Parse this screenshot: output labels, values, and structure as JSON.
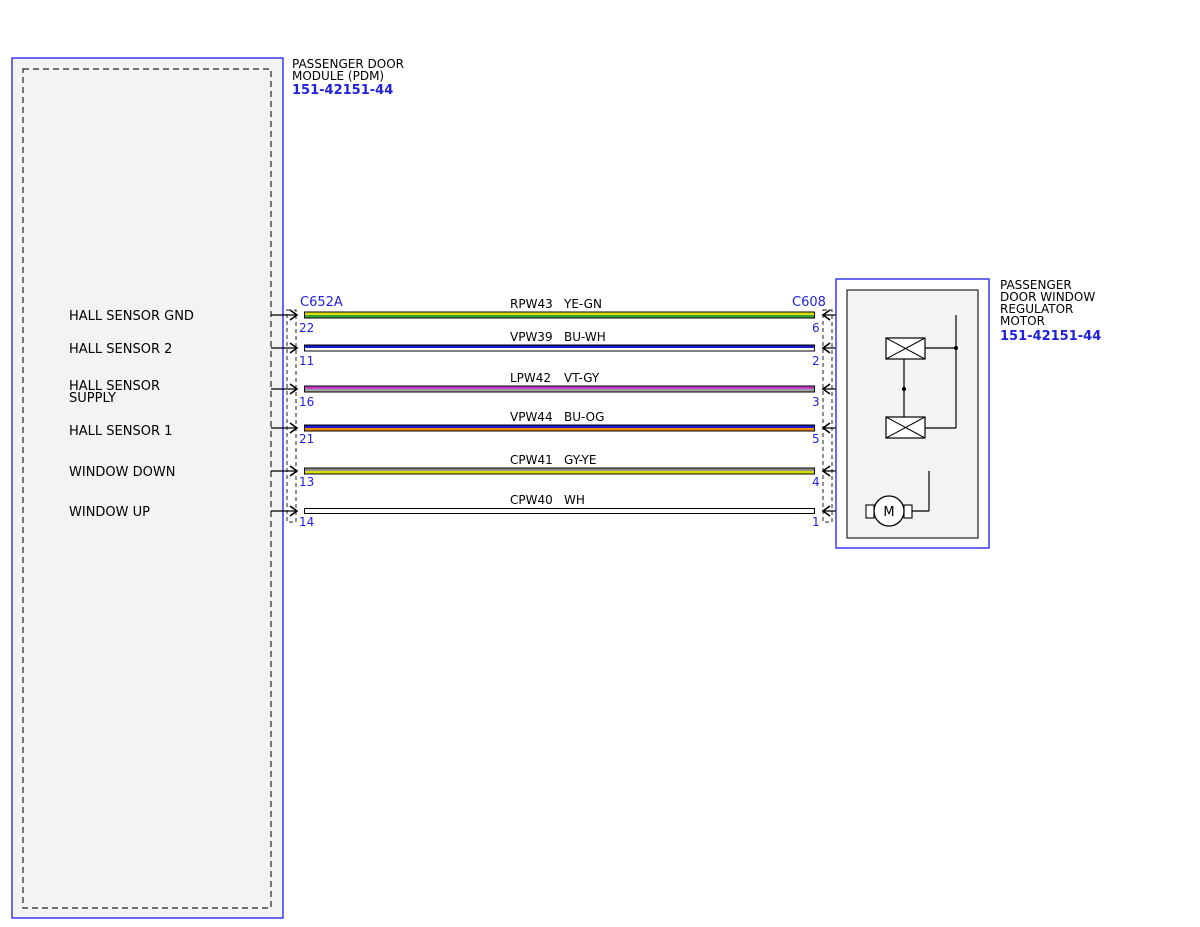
{
  "pdm": {
    "title_lines": [
      "PASSENGER DOOR",
      "MODULE (PDM)"
    ],
    "part_no": "151-42151-44",
    "connector": "C652A"
  },
  "motor": {
    "title_lines": [
      "PASSENGER",
      "DOOR WINDOW",
      "REGULATOR",
      "MOTOR"
    ],
    "part_no": "151-42151-44",
    "connector": "C608",
    "motor_symbol": "M"
  },
  "signals": [
    {
      "label_lines": [
        "HALL SENSOR GND"
      ],
      "pin_left": "22",
      "pin_right": "6",
      "circuit": "RPW43",
      "color_code": "YE-GN",
      "wire_colors": [
        "#d9e000",
        "#3aa23a"
      ]
    },
    {
      "label_lines": [
        "HALL SENSOR 2"
      ],
      "pin_left": "11",
      "pin_right": "2",
      "circuit": "VPW39",
      "color_code": "BU-WH",
      "wire_colors": [
        "#1a1ad0",
        "#ffffff"
      ]
    },
    {
      "label_lines": [
        "HALL SENSOR",
        "SUPPLY"
      ],
      "pin_left": "16",
      "pin_right": "3",
      "circuit": "LPW42",
      "color_code": "VT-GY",
      "wire_colors": [
        "#c040c8",
        "#a0a0a0"
      ]
    },
    {
      "label_lines": [
        "HALL SENSOR 1"
      ],
      "pin_left": "21",
      "pin_right": "5",
      "circuit": "VPW44",
      "color_code": "BU-OG",
      "wire_colors": [
        "#1a1ad0",
        "#f08a00"
      ]
    },
    {
      "label_lines": [
        "WINDOW DOWN"
      ],
      "pin_left": "13",
      "pin_right": "4",
      "circuit": "CPW41",
      "color_code": "GY-YE",
      "wire_colors": [
        "#909090",
        "#d9e000"
      ]
    },
    {
      "label_lines": [
        "WINDOW UP"
      ],
      "pin_left": "14",
      "pin_right": "1",
      "circuit": "CPW40",
      "color_code": "WH",
      "wire_colors": [
        "#ffffff",
        "#ffffff"
      ]
    }
  ],
  "colors": {
    "frame_blue": "#2a2af0",
    "pin_blue": "#1f1fe0",
    "box_fill": "#f3f3f3"
  }
}
